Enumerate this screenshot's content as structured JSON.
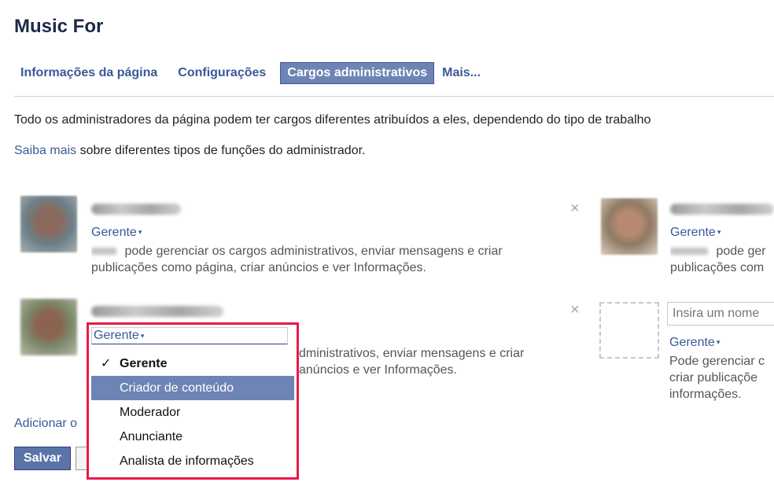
{
  "page": {
    "title": "Music For"
  },
  "tabs": [
    {
      "label": "Informações da página"
    },
    {
      "label": "Configurações"
    },
    {
      "label": "Cargos administrativos",
      "active": true
    },
    {
      "label": "Mais..."
    }
  ],
  "intro": {
    "description": "Todo os administradores da página podem ter cargos diferentes atribuídos a eles, dependendo do tipo de trabalho",
    "learn_more_link": "Saiba mais",
    "learn_more_rest": " sobre diferentes tipos de funções do administrador."
  },
  "admins": [
    {
      "role": "Gerente",
      "desc_line1": " pode gerenciar os cargos administrativos, enviar mensagens e criar",
      "desc_line2": "publicações como página, criar anúncios e ver Informações."
    },
    {
      "role": "Gerente",
      "desc_line1": "dministrativos, enviar mensagens e criar",
      "desc_line2": "anúncios e ver Informações."
    },
    {
      "role": "Gerente",
      "desc_line1": " pode ger",
      "desc_line2": "publicações com"
    }
  ],
  "new_admin": {
    "input_placeholder": "Insira um nome",
    "role": "Gerente",
    "desc_line1": "Pode gerenciar c",
    "desc_line2": "criar publicaçõe",
    "desc_line3": "informações."
  },
  "dropdown": {
    "current": "Gerente",
    "options": [
      {
        "label": "Gerente",
        "checked": true
      },
      {
        "label": "Criador de conteúdo",
        "highlighted": true
      },
      {
        "label": "Moderador"
      },
      {
        "label": "Anunciante"
      },
      {
        "label": "Analista de informações"
      }
    ],
    "check_symbol": "✓",
    "highlight_color": "#e8194b"
  },
  "footer": {
    "add_admin": "Adicionar o",
    "save_label": "Salvar"
  },
  "icons": {
    "close": "×",
    "caret": "▾"
  },
  "colors": {
    "link": "#3b5998",
    "active_tab_bg": "#6d84b4",
    "annotation_border": "#e8194b"
  }
}
